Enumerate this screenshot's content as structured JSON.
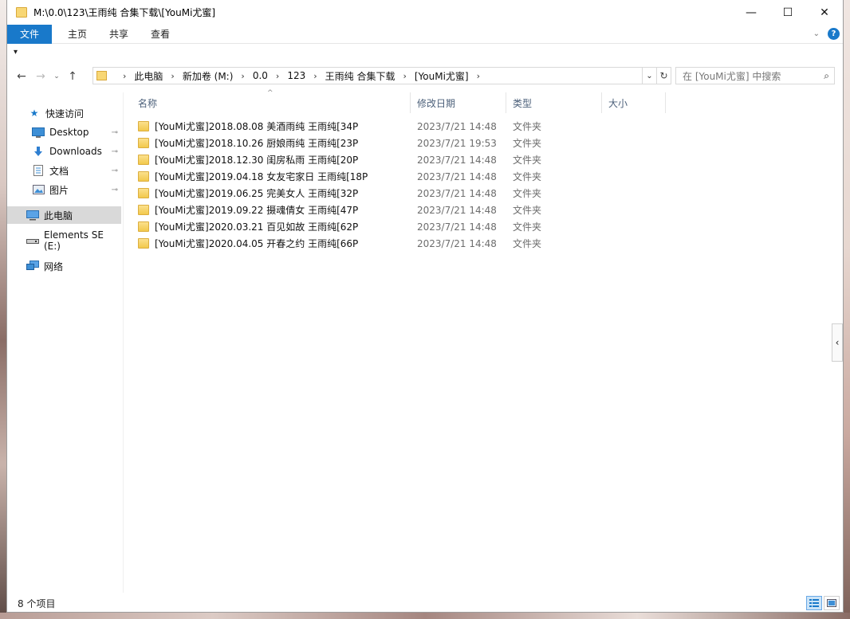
{
  "window": {
    "title": "M:\\0.0\\123\\王雨纯 合集下载\\[YouMi尤蜜]",
    "controls": {
      "minimize": "—",
      "maximize": "☐",
      "close": "✕"
    }
  },
  "ribbon": {
    "tabs": [
      "文件",
      "主页",
      "共享",
      "查看"
    ],
    "help": "?"
  },
  "qat": {
    "arrow": "▾"
  },
  "nav_buttons": {
    "back": "←",
    "forward": "→",
    "recent": "⌄",
    "up": "↑"
  },
  "address": {
    "crumbs": [
      "此电脑",
      "新加卷 (M:)",
      "0.0",
      "123",
      "王雨纯 合集下载",
      "[YouMi尤蜜]"
    ],
    "separator": "›",
    "dropdown": "⌄",
    "refresh": "↻"
  },
  "search": {
    "placeholder": "在 [YouMi尤蜜] 中搜索",
    "icon": "⌕"
  },
  "navpane": {
    "quick_access": "快速访问",
    "items": [
      {
        "label": "Desktop",
        "icon": "desktop-icon"
      },
      {
        "label": "Downloads",
        "icon": "download-icon"
      },
      {
        "label": "文档",
        "icon": "document-icon"
      },
      {
        "label": "图片",
        "icon": "pictures-icon"
      }
    ],
    "this_pc": "此电脑",
    "drive": "Elements SE (E:)",
    "network": "网络",
    "pin": "📌"
  },
  "columns": {
    "name": "名称",
    "date": "修改日期",
    "type": "类型",
    "size": "大小",
    "sort": "^"
  },
  "files": [
    {
      "name": "[YouMi尤蜜]2018.08.08 美酒雨纯 王雨纯[34P",
      "date": "2023/7/21 14:48",
      "type": "文件夹"
    },
    {
      "name": "[YouMi尤蜜]2018.10.26 厨娘雨纯 王雨纯[23P",
      "date": "2023/7/21 19:53",
      "type": "文件夹"
    },
    {
      "name": "[YouMi尤蜜]2018.12.30 闺房私雨 王雨纯[20P",
      "date": "2023/7/21 14:48",
      "type": "文件夹"
    },
    {
      "name": "[YouMi尤蜜]2019.04.18 女友宅家日 王雨纯[18P",
      "date": "2023/7/21 14:48",
      "type": "文件夹"
    },
    {
      "name": "[YouMi尤蜜]2019.06.25 完美女人 王雨纯[32P",
      "date": "2023/7/21 14:48",
      "type": "文件夹"
    },
    {
      "name": "[YouMi尤蜜]2019.09.22 摄魂倩女 王雨纯[47P",
      "date": "2023/7/21 14:48",
      "type": "文件夹"
    },
    {
      "name": "[YouMi尤蜜]2020.03.21 百见如故 王雨纯[62P",
      "date": "2023/7/21 14:48",
      "type": "文件夹"
    },
    {
      "name": "[YouMi尤蜜]2020.04.05 开春之约 王雨纯[66P",
      "date": "2023/7/21 14:48",
      "type": "文件夹"
    }
  ],
  "pane_toggle": "‹",
  "status": {
    "count": "8 个项目"
  },
  "colors": {
    "accent": "#1979ca",
    "folder": "#f8d775",
    "selected_nav": "#d9d9d9"
  }
}
